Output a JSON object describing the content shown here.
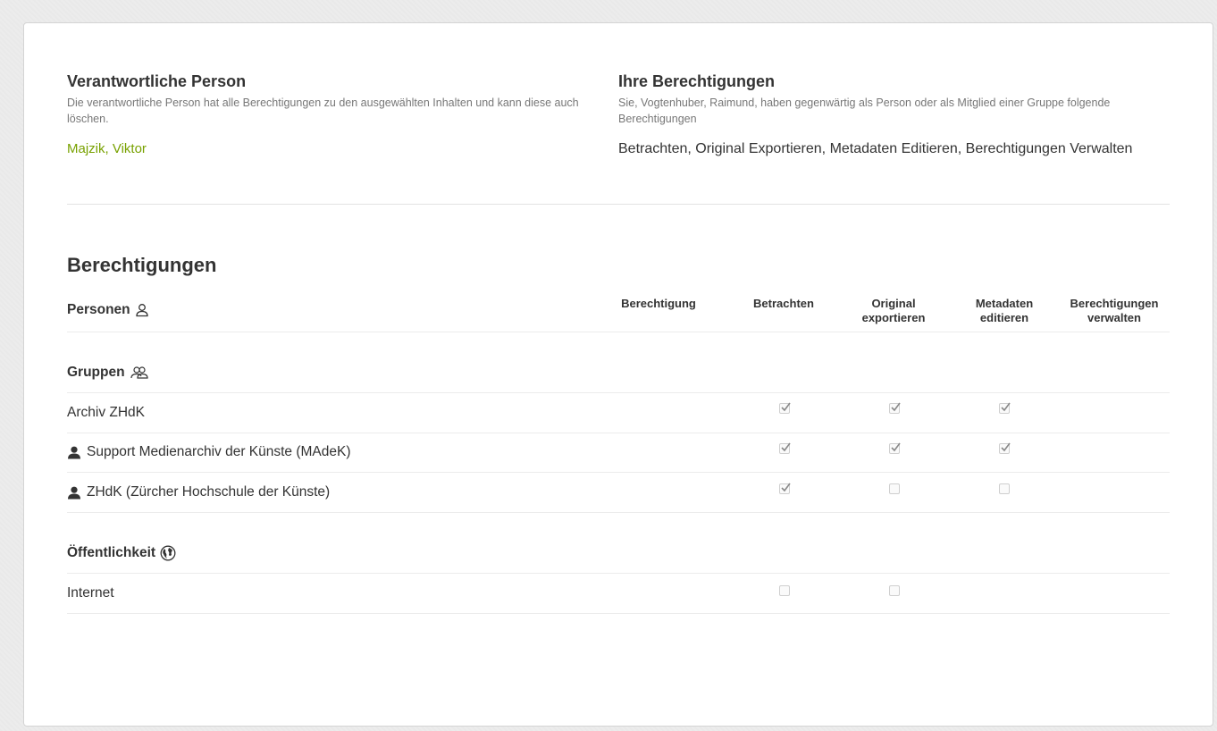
{
  "owner": {
    "title": "Verantwortliche Person",
    "description": "Die verantwortliche Person hat alle Berechtigungen zu den ausgewählten Inhalten und kann diese auch löschen.",
    "name": "Majzik, Viktor"
  },
  "your_permissions": {
    "title": "Ihre Berechtigungen",
    "description": "Sie, Vogtenhuber, Raimund, haben gegenwärtig als Person oder als Mitglied einer Gruppe folgende Berechtigungen",
    "list": "Betrachten, Original Exportieren, Metadaten Editieren, Berechtigungen Verwalten"
  },
  "permissions": {
    "title": "Berechtigungen",
    "persons_label": "Personen",
    "columns": {
      "permission": "Berechtigung",
      "view": "Betrachten",
      "export_line1": "Original",
      "export_line2": "exportieren",
      "edit_line1": "Metadaten",
      "edit_line2": "editieren",
      "manage_line1": "Berechtigungen",
      "manage_line2": "verwalten"
    },
    "groups_label": "Gruppen",
    "groups": [
      {
        "name": "Archiv ZHdK",
        "view": true,
        "export": true,
        "edit": true
      },
      {
        "name": "Support Medienarchiv der Künste (MAdeK)",
        "view": true,
        "export": true,
        "edit": true
      },
      {
        "name": "ZHdK (Zürcher Hochschule der Künste)",
        "view": true,
        "export": false,
        "edit": false
      }
    ],
    "public_label": "Öffentlichkeit",
    "public": [
      {
        "name": "Internet",
        "view": false,
        "export": false
      }
    ]
  },
  "colors": {
    "accent_green": "#78a100",
    "text": "#333333",
    "muted": "#777777"
  },
  "icons": [
    "person-outline-icon",
    "group-outline-icon",
    "person-filled-icon",
    "globe-icon",
    "check-icon"
  ]
}
